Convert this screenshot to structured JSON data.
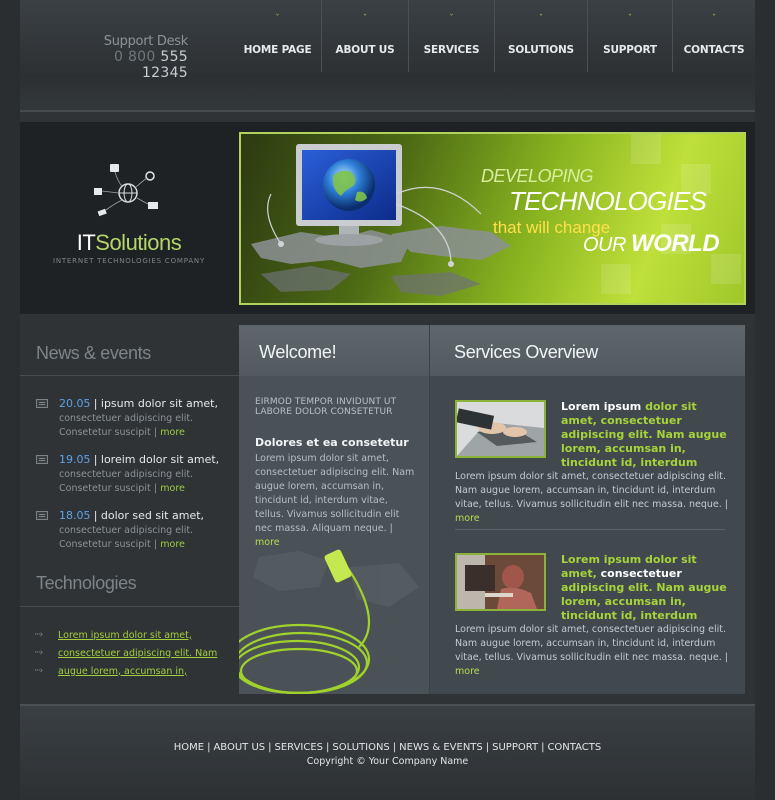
{
  "header": {
    "support_label": "Support Desk",
    "phone_prefix": "0 800",
    "phone_number": "555 12345",
    "nav": [
      {
        "label": "HOME PAGE"
      },
      {
        "label": "ABOUT US"
      },
      {
        "label": "SERVICES"
      },
      {
        "label": "SOLUTIONS"
      },
      {
        "label": "SUPPORT"
      },
      {
        "label": "CONTACTS"
      }
    ]
  },
  "banner": {
    "logo_it": "IT",
    "logo_solutions": "Solutions",
    "logo_subtitle": "INTERNET TECHNOLOGIES COMPANY",
    "hero_line1": "DEVELOPING",
    "hero_line2": "TECHNOLOGIES",
    "hero_line3": "that will change",
    "hero_line4a": "OUR",
    "hero_line4b": "WORLD"
  },
  "news": {
    "title": "News & events",
    "items": [
      {
        "date": "20.05",
        "headline": "ipsum dolor sit amet,",
        "line1": "consectetuer adipiscing elit.",
        "line2": "Consetetur suscipit",
        "more": "more"
      },
      {
        "date": "19.05",
        "headline": "loreim dolor sit amet,",
        "line1": "consectetuer adipiscing elit.",
        "line2": "Consetetur suscipit",
        "more": "more"
      },
      {
        "date": "18.05",
        "headline": "dolor sed sit amet,",
        "line1": "consectetuer adipiscing elit.",
        "line2": "Consetetur suscipit",
        "more": "more"
      }
    ]
  },
  "technologies": {
    "title": "Technologies",
    "links": [
      "Lorem ipsum dolor sit amet,",
      "consectetuer adipiscing elit. Nam",
      "augue lorem, accumsan in,"
    ]
  },
  "welcome": {
    "title": "Welcome!",
    "caps": "Eirmod tempor invidunt ut labore dolor consetetur",
    "subtitle": "Dolores et ea consetetur",
    "paragraph": "Lorem ipsum dolor sit amet, consectetuer adipiscing elit. Nam augue lorem, accumsan in, tincidunt id, interdum vitae, tellus. Vivamus sollicitudin elit nec massa. Aliquam neque.",
    "more": "more"
  },
  "services": {
    "title": "Services Overview",
    "items": [
      {
        "head_white": "Lorem ipsum",
        "head_green": "dolor sit amet, consectetuer adipiscing elit. Nam augue lorem, accumsan in, tincidunt id, interdum",
        "paragraph": "Lorem ipsum dolor sit amet, consectetuer adipiscing elit. Nam augue lorem, accumsan in, tincidunt id, interdum vitae, tellus. Vivamus sollicitudin elit nec massa. neque.",
        "more": "more"
      },
      {
        "head_green_a": "Lorem ipsum dolor sit amet,",
        "head_white": "consectetuer",
        "head_green_b": "adipiscing elit. Nam augue lorem, accumsan in, tincidunt id, interdum",
        "paragraph": "Lorem ipsum dolor sit amet, consectetuer adipiscing elit. Nam augue lorem, accumsan in, tincidunt id, interdum vitae, tellus. Vivamus sollicitudin elit nec massa. neque.",
        "more": "more"
      }
    ]
  },
  "footer": {
    "links": [
      "HOME",
      "ABOUT US",
      "SERVICES",
      "SOLUTIONS",
      "NEWS & EVENTS",
      "SUPPORT",
      "CONTACTS"
    ],
    "copyright": "Copyright © Your Company Name"
  },
  "colors": {
    "accent_green": "#a5d43a",
    "date_blue": "#5ea2e6",
    "background": "#2a2e31"
  }
}
